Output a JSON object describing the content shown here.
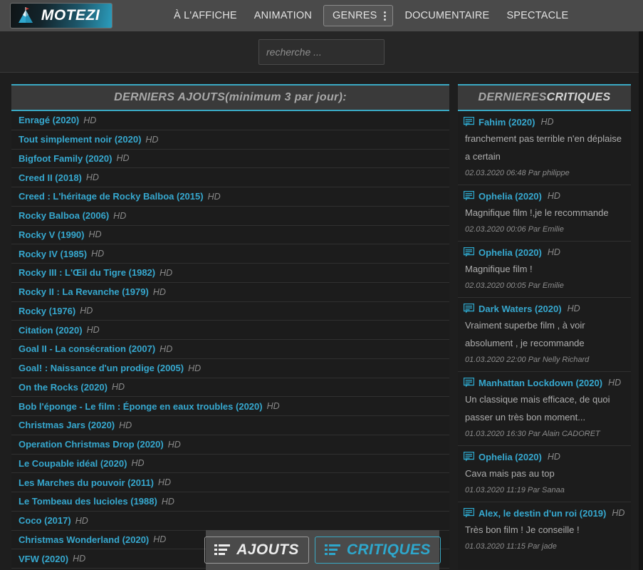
{
  "header": {
    "brand_name": "MOTEZI",
    "logo_icon": "mountain-flag-icon",
    "nav": [
      {
        "label": "À L'AFFICHE",
        "boxed": false
      },
      {
        "label": "ANIMATION",
        "boxed": false
      },
      {
        "label": "GENRES",
        "boxed": true,
        "icon": "kebab-menu-icon"
      },
      {
        "label": "DOCUMENTAIRE",
        "boxed": false
      },
      {
        "label": "SPECTACLE",
        "boxed": false
      }
    ]
  },
  "search": {
    "placeholder": "recherche ...",
    "value": ""
  },
  "additions_panel": {
    "title_italic": "DERNIERS AJOUTS",
    "title_suffix": " (minimum 3 par jour):",
    "items": [
      {
        "title": "Enragé (2020)",
        "quality": "HD"
      },
      {
        "title": "Tout simplement noir (2020)",
        "quality": "HD"
      },
      {
        "title": "Bigfoot Family (2020)",
        "quality": "HD"
      },
      {
        "title": "Creed II (2018)",
        "quality": "HD"
      },
      {
        "title": "Creed : L'héritage de Rocky Balboa (2015)",
        "quality": "HD"
      },
      {
        "title": "Rocky Balboa (2006)",
        "quality": "HD"
      },
      {
        "title": "Rocky V (1990)",
        "quality": "HD"
      },
      {
        "title": "Rocky IV (1985)",
        "quality": "HD"
      },
      {
        "title": "Rocky III : L'Œil du Tigre (1982)",
        "quality": "HD"
      },
      {
        "title": "Rocky II : La Revanche (1979)",
        "quality": "HD"
      },
      {
        "title": "Rocky (1976)",
        "quality": "HD"
      },
      {
        "title": "Citation (2020)",
        "quality": "HD"
      },
      {
        "title": "Goal II - La consécration (2007)",
        "quality": "HD"
      },
      {
        "title": "Goal! : Naissance d'un prodige (2005)",
        "quality": "HD"
      },
      {
        "title": "On the Rocks (2020)",
        "quality": "HD"
      },
      {
        "title": "Bob l'éponge - Le film : Éponge en eaux troubles (2020)",
        "quality": "HD"
      },
      {
        "title": "Christmas Jars (2020)",
        "quality": "HD"
      },
      {
        "title": "Operation Christmas Drop (2020)",
        "quality": "HD"
      },
      {
        "title": "Le Coupable idéal (2020)",
        "quality": "HD"
      },
      {
        "title": "Les Marches du pouvoir (2011)",
        "quality": "HD"
      },
      {
        "title": "Le Tombeau des lucioles (1988)",
        "quality": "HD"
      },
      {
        "title": "Coco (2017)",
        "quality": "HD"
      },
      {
        "title": "Christmas Wonderland (2020)",
        "quality": "HD"
      },
      {
        "title": "VFW (2020)",
        "quality": "HD"
      }
    ]
  },
  "reviews_panel": {
    "title_italic": "DERNIERES ",
    "title_bold": "CRITIQUES",
    "items": [
      {
        "title": "Fahim (2020)",
        "quality": "HD",
        "text": "franchement pas terrible n'en déplaise a certain",
        "meta": "02.03.2020 06:48 Par philippe"
      },
      {
        "title": "Ophelia (2020)",
        "quality": "HD",
        "text": "Magnifique film !,je le recommande",
        "meta": "02.03.2020 00:06 Par Emilie"
      },
      {
        "title": "Ophelia (2020)",
        "quality": "HD",
        "text": "Magnifique film !",
        "meta": "02.03.2020 00:05 Par Emilie"
      },
      {
        "title": "Dark Waters (2020)",
        "quality": "HD",
        "text": "Vraiment superbe film , à voir absolument , je recommande",
        "meta": "01.03.2020 22:00 Par Nelly Richard"
      },
      {
        "title": "Manhattan Lockdown (2020)",
        "quality": "HD",
        "text": "Un classique mais efficace, de quoi passer un très bon moment...",
        "meta": "01.03.2020 16:30 Par Alain CADORET"
      },
      {
        "title": "Ophelia (2020)",
        "quality": "HD",
        "text": "Cava mais pas au top",
        "meta": "01.03.2020 11:19 Par Sanaa"
      },
      {
        "title": "Alex, le destin d'un roi (2019)",
        "quality": "HD",
        "text": "Très bon film ! Je conseille !",
        "meta": "01.03.2020 11:15 Par jade"
      }
    ]
  },
  "bottom_toggle": {
    "ajouts_label": "AJOUTS",
    "critiques_label": "CRITIQUES",
    "ajouts_icon": "list-icon",
    "critiques_icon": "list-icon"
  },
  "colors": {
    "accent": "#36a8cf",
    "accent_border": "#3aa9c4",
    "background": "#1e1e1e",
    "header_bg": "#4a4a4a",
    "panel_header_bg": "#3a3a3a",
    "muted_text": "#8a8a8a"
  }
}
